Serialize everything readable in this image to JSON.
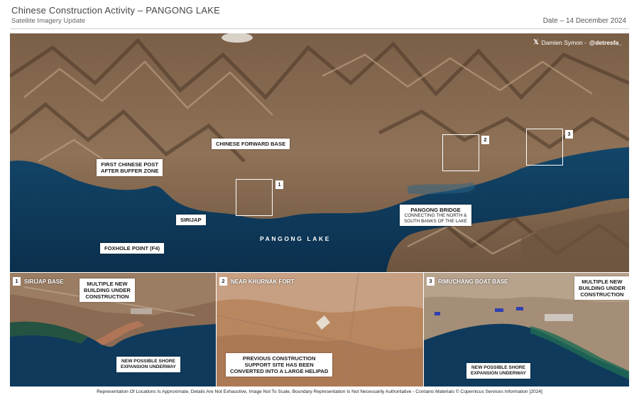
{
  "header": {
    "title": "Chinese Construction Activity  – PANGONG LAKE",
    "subtitle": "Satellite Imagery Update",
    "date": "Date – 14 December 2024"
  },
  "credit": {
    "prefix": "Damien Symon - ",
    "handle": "@detresfa_",
    "icon": "x-logo-icon"
  },
  "map": {
    "lake_label": "PANGONG LAKE",
    "colors": {
      "water": "#0f3a5c",
      "terrain": "#8a6d50",
      "ridge_dark": "#4a3626",
      "ridge_light": "#b7977a",
      "snow": "#e9e6e1"
    },
    "callouts": {
      "forward_base": "CHINESE FORWARD BASE",
      "first_post_1": "FIRST CHINESE POST",
      "first_post_2": "AFTER BUFFER ZONE",
      "sirijap": "SIRIJAP",
      "foxhole": "FOXHOLE POINT (F4)",
      "bridge_title": "PANGONG BRIDGE",
      "bridge_sub_1": "CONNECTING THE NORTH &",
      "bridge_sub_2": "SOUTH BANKS OF THE LAKE"
    },
    "boxes": [
      "1",
      "2",
      "3"
    ]
  },
  "insets": [
    {
      "number": "1",
      "title": "SIRIJAP BASE",
      "callouts": [
        "MULTIPLE NEW",
        "BUILDING UNDER",
        "CONSTRUCTION"
      ],
      "callouts_b": [
        "NEW POSSIBLE SHORE",
        "EXPANSION UNDERWAY"
      ]
    },
    {
      "number": "2",
      "title": "NEAR KHURNAK FORT",
      "callouts": [
        "PREVIOUS CONSTRUCTION",
        "SUPPORT SITE HAS BEEN",
        "CONVERTED INTO A LARGE HELIPAD"
      ]
    },
    {
      "number": "3",
      "title": "RIMUCHANG BOAT BASE",
      "callouts": [
        "MULTIPLE NEW",
        "BUILDING UNDER",
        "CONSTRUCTION"
      ],
      "callouts_b": [
        "NEW POSSIBLE SHORE",
        "EXPANSION UNDERWAY"
      ]
    }
  ],
  "footer": "Representation Of Locations Is Approximate, Details Are Not Exhaustive, Image Not To Scale, Boundary Representation Is Not Necessarily Authoritative - Contains Materials © Copernicus Services Information  [2024]"
}
